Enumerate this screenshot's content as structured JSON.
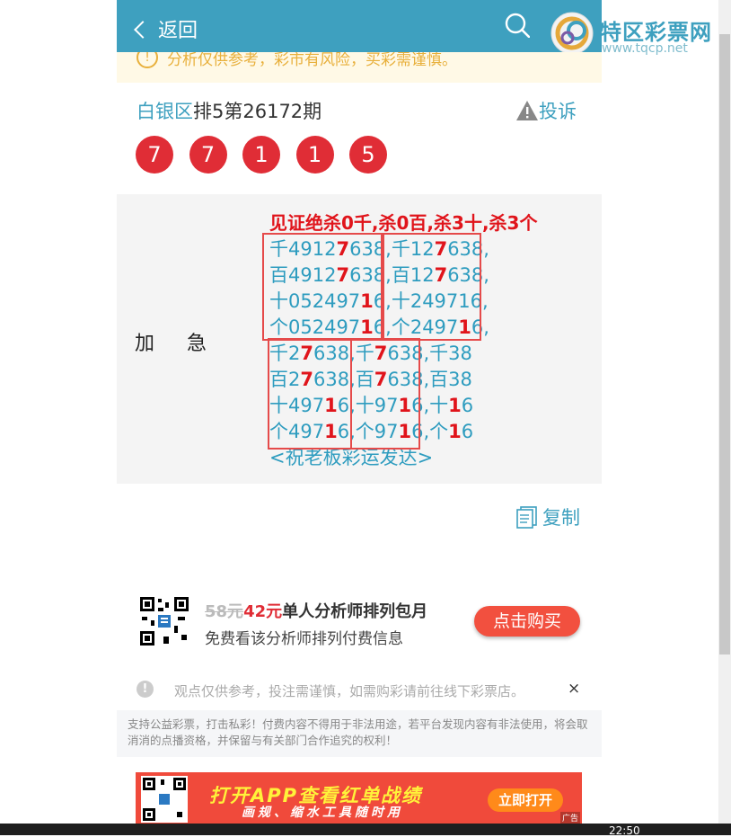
{
  "header": {
    "back_label": "返回",
    "brand_name": "特区彩票网",
    "brand_url": "www.tqcp.net",
    "accent_color": "#3ea0bf"
  },
  "notice": {
    "text": "分析仅供参考，彩市有风险，买彩需谨慎。"
  },
  "draw": {
    "area": "白银区",
    "title_rest": "排5第26172期",
    "complain_label": "投诉",
    "balls": [
      "7",
      "7",
      "1",
      "1",
      "5"
    ],
    "ball_color": "#e02d36"
  },
  "analysis": {
    "label": "加急",
    "headline": "见证绝杀0千,杀0百,杀3十,杀3个",
    "footer": "<祝老板彩运发达>"
  },
  "copy_label": "复制",
  "promo": {
    "old_price": "58元",
    "new_price": "42元",
    "title": "单人分析师排列包月",
    "subtitle": "免费看该分析师排列付费信息",
    "button": "点击购买"
  },
  "tip": {
    "text": "观点仅供参考，投注需谨慎，如需购彩请前往线下彩票店。",
    "close": "×"
  },
  "disclaimer": "支持公益彩票，打击私彩！付费内容不得用于非法用途，若平台发现内容有非法使用，将会取消消的点播资格，并保留与有关部门合作追究的权利！",
  "banner": {
    "line1": "打开APP查看红单战绩",
    "line2": "画规、缩水工具随时用",
    "button": "立即打开",
    "ad_label": "广告"
  },
  "taskbar": {
    "clock": "22:50"
  }
}
